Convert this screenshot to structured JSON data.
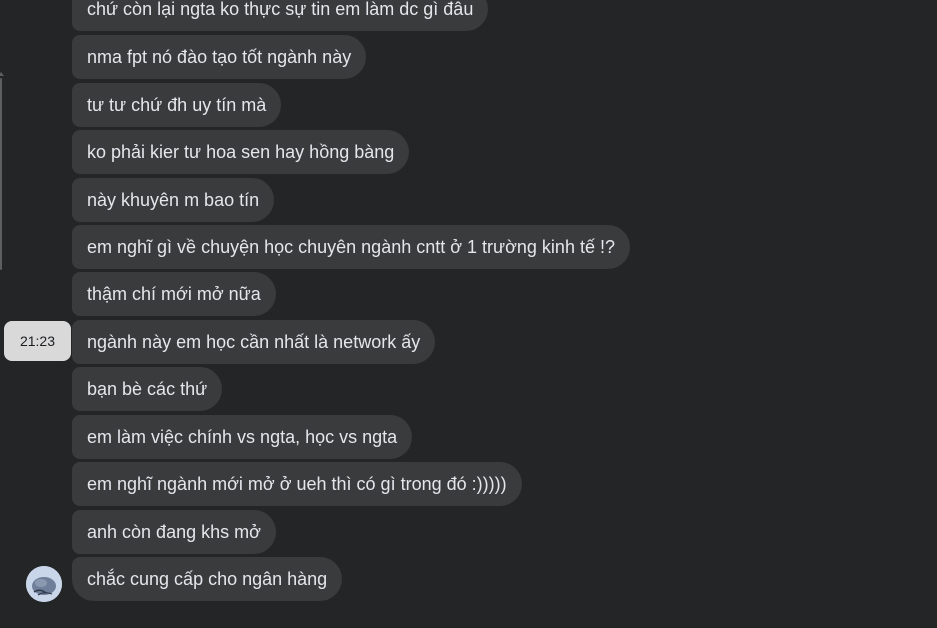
{
  "messages": [
    "chứ còn lại ngta ko thực sự tin em làm dc gì đâu",
    "nma fpt nó đào tạo tốt ngành này",
    "tư tư chứ đh uy tín mà",
    "ko phải kier tư hoa sen hay hồng bàng",
    "này khuyên m bao tín",
    "em nghĩ gì về chuyện học chuyên ngành cntt ở 1 trường kinh tế !?",
    "thậm chí mới mở nữa",
    "ngành này em học cần nhất là network ấy",
    "bạn bè các thứ",
    "em làm việc chính vs ngta, học vs ngta",
    "em nghĩ ngành mới mở ở ueh thì có gì trong đó :)))))",
    "anh còn đang khs mở",
    "chắc cung cấp cho ngân hàng"
  ],
  "timestamp": "21:23",
  "avatar_icon": "sender-avatar",
  "colors": {
    "background": "#242526",
    "bubble": "#3a3b3c",
    "text": "#e4e6eb",
    "tooltip_bg": "#d9d9d9",
    "tooltip_text": "#1c1e21"
  }
}
